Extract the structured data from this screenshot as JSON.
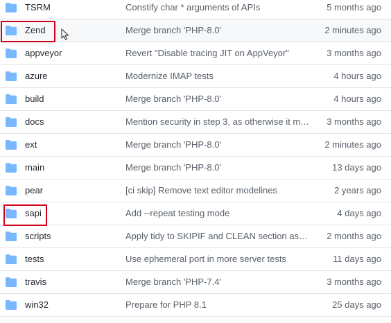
{
  "colors": {
    "folder_icon": "#79b8ff",
    "highlight_box": "#d0021b",
    "row_divider": "#e1e4e8",
    "hover_row": "#f6f8fa"
  },
  "files": [
    {
      "name": "TSRM",
      "message": "Constify char * arguments of APIs",
      "age": "5 months ago",
      "icon": "folder-icon"
    },
    {
      "name": "Zend",
      "message": "Merge branch 'PHP-8.0'",
      "age": "2 minutes ago",
      "icon": "folder-icon"
    },
    {
      "name": "appveyor",
      "message": "Revert \"Disable tracing JIT on AppVeyor\"",
      "age": "3 months ago",
      "icon": "folder-icon"
    },
    {
      "name": "azure",
      "message": "Modernize IMAP tests",
      "age": "4 hours ago",
      "icon": "folder-icon"
    },
    {
      "name": "build",
      "message": "Merge branch 'PHP-8.0'",
      "age": "4 hours ago",
      "icon": "folder-icon"
    },
    {
      "name": "docs",
      "message": "Mention security in step 3, as otherwise it mig…",
      "age": "3 months ago",
      "icon": "folder-icon"
    },
    {
      "name": "ext",
      "message": "Merge branch 'PHP-8.0'",
      "age": "2 minutes ago",
      "icon": "folder-icon"
    },
    {
      "name": "main",
      "message": "Merge branch 'PHP-8.0'",
      "age": "13 days ago",
      "icon": "folder-icon"
    },
    {
      "name": "pear",
      "message": "[ci skip] Remove text editor modelines",
      "age": "2 years ago",
      "icon": "folder-icon"
    },
    {
      "name": "sapi",
      "message": "Add --repeat testing mode",
      "age": "4 days ago",
      "icon": "folder-icon"
    },
    {
      "name": "scripts",
      "message": "Apply tidy to SKIPIF and CLEAN section as well",
      "age": "2 months ago",
      "icon": "folder-icon"
    },
    {
      "name": "tests",
      "message": "Use ephemeral port in more server tests",
      "age": "11 days ago",
      "icon": "folder-icon"
    },
    {
      "name": "travis",
      "message": "Merge branch 'PHP-7.4'",
      "age": "3 months ago",
      "icon": "folder-icon"
    },
    {
      "name": "win32",
      "message": "Prepare for PHP 8.1",
      "age": "25 days ago",
      "icon": "folder-icon"
    }
  ]
}
